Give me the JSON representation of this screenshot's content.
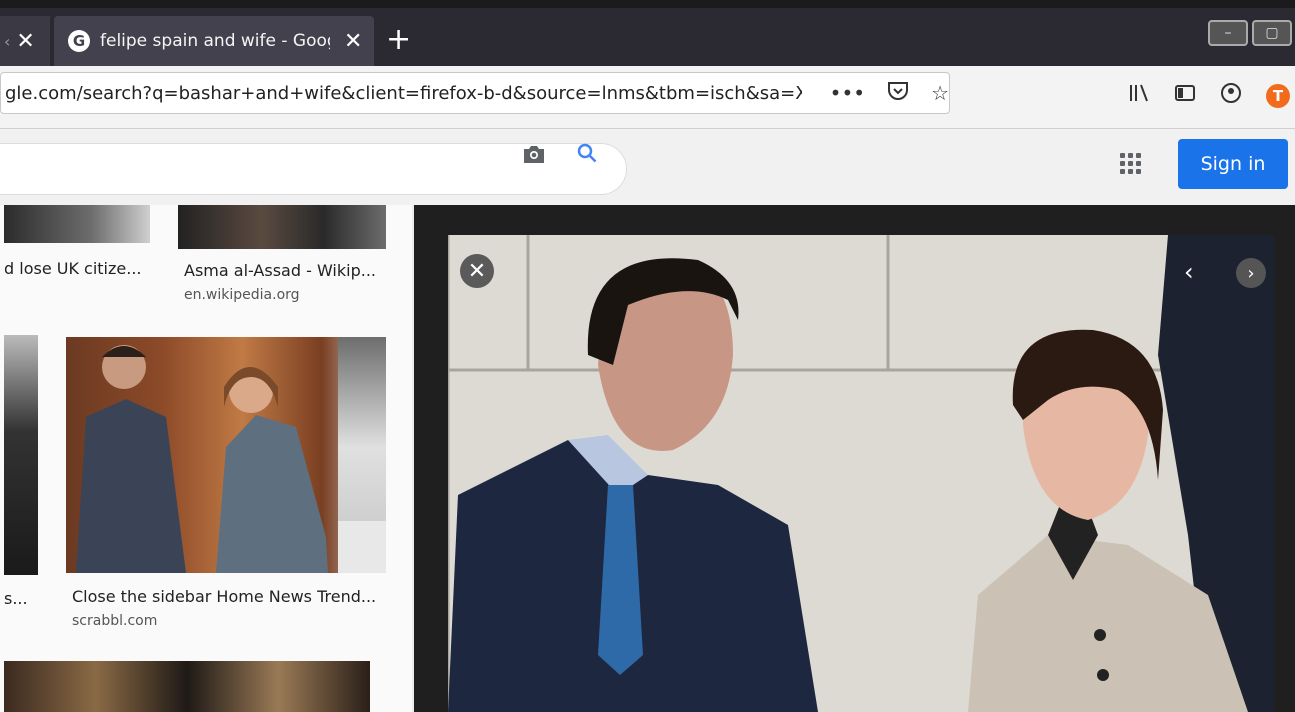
{
  "tabs": {
    "prev_close": "✕",
    "active_title": "felipe spain and wife - Google",
    "active_close": "✕",
    "new_tab": "+"
  },
  "urlbar": {
    "url": "gle.com/search?q=bashar+and+wife&client=firefox-b-d&source=lnms&tbm=isch&sa=X&",
    "more": "•••"
  },
  "header": {
    "sign_in": "Sign in"
  },
  "results": {
    "row1": [
      {
        "caption": "d lose UK citize...",
        "source": ""
      },
      {
        "caption": "Asma al-Assad - Wikip...",
        "source": "en.wikipedia.org"
      }
    ],
    "row2": [
      {
        "caption": "s...",
        "source": ""
      },
      {
        "caption": "Close the sidebar Home News Trend...",
        "source": "scrabbl.com"
      }
    ]
  },
  "preview": {
    "close": "✕",
    "prev": "‹",
    "next": "›"
  },
  "colors": {
    "accent": "#1a73e8",
    "tab_bg": "#2b2a33",
    "profile": "#f26a1b"
  }
}
